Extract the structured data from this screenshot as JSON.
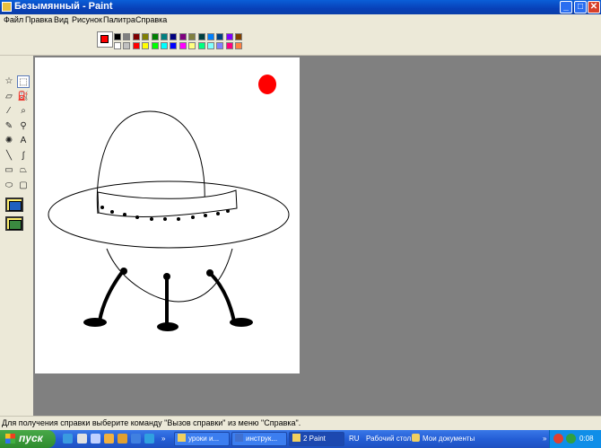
{
  "window": {
    "title": "Безымянный - Paint",
    "buttons": [
      "_",
      "□",
      "✕"
    ]
  },
  "menu": [
    "Файл",
    "Правка",
    "Вид",
    "Рисунок",
    "Палитра",
    "Справка"
  ],
  "colors": {
    "foreground": "#ff0000",
    "background": "#ffffff",
    "palette": [
      "#000000",
      "#808080",
      "#800000",
      "#808000",
      "#008000",
      "#008080",
      "#000080",
      "#800080",
      "#808040",
      "#004040",
      "#0080ff",
      "#004080",
      "#8000ff",
      "#804000",
      "#ffffff",
      "#c0c0c0",
      "#ff0000",
      "#ffff00",
      "#00ff00",
      "#00ffff",
      "#0000ff",
      "#ff00ff",
      "#ffff80",
      "#00ff80",
      "#80ffff",
      "#8080ff",
      "#ff0080",
      "#ff8040"
    ]
  },
  "tools": [
    {
      "name": "free-select-icon",
      "glyph": "☆"
    },
    {
      "name": "rect-select-icon",
      "glyph": "⬚"
    },
    {
      "name": "eraser-icon",
      "glyph": "▱"
    },
    {
      "name": "fill-bucket-icon",
      "glyph": "⛽"
    },
    {
      "name": "color-picker-icon",
      "glyph": "⁄"
    },
    {
      "name": "magnifier-icon",
      "glyph": "⌕"
    },
    {
      "name": "pencil-icon",
      "glyph": "✎"
    },
    {
      "name": "brush-icon",
      "glyph": "⚲"
    },
    {
      "name": "airbrush-icon",
      "glyph": "✺"
    },
    {
      "name": "text-tool-icon",
      "glyph": "A"
    },
    {
      "name": "line-tool-icon",
      "glyph": "╲"
    },
    {
      "name": "curve-tool-icon",
      "glyph": "∫"
    },
    {
      "name": "rectangle-tool-icon",
      "glyph": "▭"
    },
    {
      "name": "polygon-tool-icon",
      "glyph": "⏢"
    },
    {
      "name": "ellipse-tool-icon",
      "glyph": "⬭"
    },
    {
      "name": "rounded-rect-tool-icon",
      "glyph": "▢"
    }
  ],
  "status": "Для получения справки выберите команду \"Вызов справки\" из меню \"Справка\".",
  "taskbar": {
    "start": "пуск",
    "tasks": [
      "уроки и...",
      "инструк...",
      "2 Paint"
    ],
    "lang": "RU",
    "desktop": "Рабочий стол",
    "docs": "Мои документы",
    "chevron": "»",
    "clock": "0:08"
  }
}
